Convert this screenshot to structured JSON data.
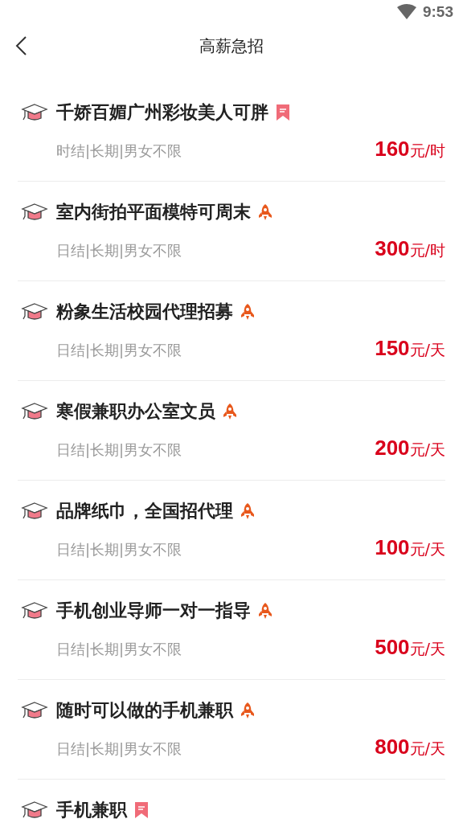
{
  "status_bar": {
    "time": "9:53"
  },
  "header": {
    "title": "高薪急招"
  },
  "jobs": [
    {
      "title": "千娇百媚广州彩妆美人可胖",
      "badge": {
        "kind": "ribbon"
      },
      "meta": "时结|长期|男女不限",
      "price": "160",
      "unit": "元/时"
    },
    {
      "title": "室内街拍平面模特可周末",
      "badge": {
        "kind": "rocket"
      },
      "meta": "日结|长期|男女不限",
      "price": "300",
      "unit": "元/时"
    },
    {
      "title": "粉象生活校园代理招募",
      "badge": {
        "kind": "rocket"
      },
      "meta": "日结|长期|男女不限",
      "price": "150",
      "unit": "元/天"
    },
    {
      "title": "寒假兼职办公室文员",
      "badge": {
        "kind": "rocket"
      },
      "meta": "日结|长期|男女不限",
      "price": "200",
      "unit": "元/天"
    },
    {
      "title": "品牌纸巾，全国招代理",
      "badge": {
        "kind": "rocket"
      },
      "meta": "日结|长期|男女不限",
      "price": "100",
      "unit": "元/天"
    },
    {
      "title": "手机创业导师一对一指导",
      "badge": {
        "kind": "rocket"
      },
      "meta": "日结|长期|男女不限",
      "price": "500",
      "unit": "元/天"
    },
    {
      "title": "随时可以做的手机兼职",
      "badge": {
        "kind": "rocket"
      },
      "meta": "日结|长期|男女不限",
      "price": "800",
      "unit": "元/天"
    },
    {
      "title": "手机兼职",
      "badge": {
        "kind": "ribbon"
      }
    }
  ]
}
